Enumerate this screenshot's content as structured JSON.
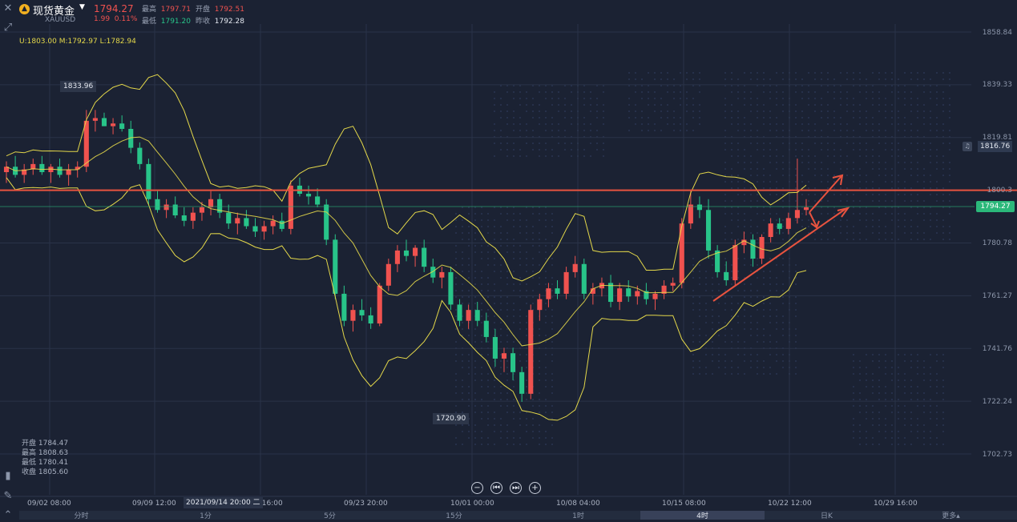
{
  "header": {
    "symbol_name": "现货黄金",
    "symbol_code": "XAUUSD",
    "last_price": "1794.27",
    "change": "1.99",
    "change_pct": "0.11%",
    "high_label": "最高",
    "high_value": "1797.71",
    "open_label": "开盘",
    "open_value": "1792.51",
    "low_label": "最低",
    "low_value": "1791.20",
    "prev_close_label": "昨收",
    "prev_close_value": "1792.28"
  },
  "bollinger": "U:1803.00  M:1792.97  L:1782.94",
  "hover_ohlc": {
    "open": "开盘 1784.47",
    "high": "最高 1808.63",
    "low": "最低 1780.41",
    "close": "收盘 1805.60"
  },
  "crosshair_date": "2021/09/14 20:00 二",
  "price_tag": "1794.27",
  "alert_price": "1816.76",
  "extreme_high": "1833.96",
  "extreme_low": "1720.90",
  "timeframes": [
    "分时",
    "1分",
    "5分",
    "15分",
    "1时",
    "4时",
    "日K",
    "更多▴"
  ],
  "active_timeframe": 5,
  "colors": {
    "up": "#f0524f",
    "down": "#28c489",
    "band": "#e4d84a",
    "resistance": "#e8533f",
    "bg": "#1b2233"
  },
  "icons": [
    "close-icon",
    "draw-tool-icon",
    "indicator-icon",
    "pen-icon",
    "collapse-icon",
    "zoom-out-icon",
    "prev-icon",
    "next-icon",
    "zoom-in-icon",
    "bell-icon"
  ],
  "chart_data": {
    "type": "candlestick",
    "ylim": [
      1695,
      1865
    ],
    "y_ticks": [
      1858.84,
      1839.33,
      1819.81,
      1800.3,
      1780.78,
      1761.27,
      1741.76,
      1722.24,
      1702.73
    ],
    "x_ticks": [
      "09/02 08:00",
      "09/09 12:00",
      "09/16 16:00",
      "09/23 20:00",
      "10/01 00:00",
      "10/08 04:00",
      "10/15 08:00",
      "10/22 12:00",
      "10/29 16:00"
    ],
    "resistance_level": 1800.3,
    "last_close": 1794.27,
    "anchors": [
      [
        1808
      ],
      [
        1812
      ],
      [
        1809
      ],
      [
        1806
      ],
      [
        1809
      ],
      [
        1828
      ],
      [
        1825
      ],
      [
        1822
      ],
      [
        1812
      ],
      [
        1808
      ],
      [
        1795
      ],
      [
        1792
      ],
      [
        1788
      ],
      [
        1793
      ],
      [
        1797
      ],
      [
        1791
      ],
      [
        1786
      ],
      [
        1790
      ],
      [
        1788
      ],
      [
        1784
      ],
      [
        1786
      ],
      [
        1787
      ],
      [
        1800
      ],
      [
        1800
      ],
      [
        1797
      ],
      [
        1791
      ],
      [
        1760
      ],
      [
        1753
      ],
      [
        1757
      ],
      [
        1751
      ],
      [
        1764
      ],
      [
        1779
      ],
      [
        1776
      ],
      [
        1779
      ],
      [
        1765
      ],
      [
        1769
      ],
      [
        1758
      ],
      [
        1752
      ],
      [
        1757
      ],
      [
        1752
      ],
      [
        1747
      ],
      [
        1737
      ],
      [
        1738
      ],
      [
        1733
      ],
      [
        1724
      ],
      [
        1756
      ],
      [
        1763
      ],
      [
        1764
      ],
      [
        1762
      ],
      [
        1766
      ],
      [
        1774
      ],
      [
        1763
      ],
      [
        1765
      ],
      [
        1766
      ],
      [
        1760
      ],
      [
        1767
      ],
      [
        1762
      ],
      [
        1763
      ],
      [
        1761
      ],
      [
        1765
      ],
      [
        1766
      ],
      [
        1793
      ],
      [
        1796
      ],
      [
        1793
      ],
      [
        1777
      ],
      [
        1770
      ],
      [
        1767
      ],
      [
        1779
      ],
      [
        1782
      ],
      [
        1775
      ],
      [
        1782
      ],
      [
        1788
      ],
      [
        1787
      ],
      [
        1789
      ],
      [
        1793
      ],
      [
        1795
      ]
    ],
    "candles": [
      [
        1807,
        1811,
        1803,
        1809
      ],
      [
        1809,
        1813,
        1805,
        1806
      ],
      [
        1806,
        1810,
        1803,
        1808
      ],
      [
        1808,
        1812,
        1806,
        1810
      ],
      [
        1810,
        1813,
        1806,
        1807
      ],
      [
        1807,
        1810,
        1803,
        1809
      ],
      [
        1809,
        1812,
        1805,
        1806
      ],
      [
        1806,
        1810,
        1802,
        1808
      ],
      [
        1808,
        1811,
        1805,
        1809
      ],
      [
        1809,
        1830,
        1807,
        1826
      ],
      [
        1826,
        1830,
        1822,
        1827
      ],
      [
        1827,
        1829,
        1824,
        1824
      ],
      [
        1824,
        1827,
        1821,
        1825
      ],
      [
        1825,
        1828,
        1822,
        1823
      ],
      [
        1823,
        1826,
        1814,
        1816
      ],
      [
        1816,
        1818,
        1808,
        1810
      ],
      [
        1810,
        1812,
        1795,
        1797
      ],
      [
        1797,
        1800,
        1792,
        1793
      ],
      [
        1793,
        1797,
        1790,
        1795
      ],
      [
        1795,
        1798,
        1790,
        1791
      ],
      [
        1791,
        1794,
        1787,
        1789
      ],
      [
        1789,
        1794,
        1786,
        1792
      ],
      [
        1792,
        1796,
        1789,
        1794
      ],
      [
        1794,
        1800,
        1791,
        1797
      ],
      [
        1797,
        1799,
        1790,
        1792
      ],
      [
        1792,
        1795,
        1786,
        1788
      ],
      [
        1788,
        1792,
        1784,
        1790
      ],
      [
        1790,
        1793,
        1786,
        1787
      ],
      [
        1787,
        1790,
        1783,
        1785
      ],
      [
        1785,
        1789,
        1782,
        1787
      ],
      [
        1787,
        1791,
        1784,
        1789
      ],
      [
        1789,
        1792,
        1785,
        1786
      ],
      [
        1786,
        1804,
        1784,
        1802
      ],
      [
        1802,
        1805,
        1798,
        1799
      ],
      [
        1799,
        1802,
        1795,
        1798
      ],
      [
        1798,
        1801,
        1794,
        1795
      ],
      [
        1795,
        1797,
        1780,
        1782
      ],
      [
        1782,
        1784,
        1760,
        1762
      ],
      [
        1762,
        1765,
        1750,
        1752
      ],
      [
        1752,
        1758,
        1748,
        1756
      ],
      [
        1756,
        1760,
        1752,
        1754
      ],
      [
        1754,
        1757,
        1749,
        1751
      ],
      [
        1751,
        1766,
        1750,
        1765
      ],
      [
        1765,
        1775,
        1763,
        1773
      ],
      [
        1773,
        1780,
        1770,
        1778
      ],
      [
        1778,
        1782,
        1774,
        1776
      ],
      [
        1776,
        1780,
        1772,
        1779
      ],
      [
        1779,
        1782,
        1770,
        1772
      ],
      [
        1772,
        1775,
        1766,
        1768
      ],
      [
        1768,
        1772,
        1764,
        1770
      ],
      [
        1770,
        1772,
        1756,
        1758
      ],
      [
        1758,
        1760,
        1750,
        1752
      ],
      [
        1752,
        1758,
        1749,
        1756
      ],
      [
        1756,
        1759,
        1750,
        1752
      ],
      [
        1752,
        1755,
        1744,
        1746
      ],
      [
        1746,
        1749,
        1735,
        1738
      ],
      [
        1738,
        1742,
        1733,
        1740
      ],
      [
        1740,
        1742,
        1730,
        1733
      ],
      [
        1733,
        1735,
        1722,
        1725
      ],
      [
        1725,
        1758,
        1723,
        1756
      ],
      [
        1756,
        1762,
        1752,
        1760
      ],
      [
        1760,
        1766,
        1757,
        1764
      ],
      [
        1764,
        1767,
        1760,
        1762
      ],
      [
        1762,
        1772,
        1760,
        1770
      ],
      [
        1770,
        1776,
        1768,
        1773
      ],
      [
        1773,
        1775,
        1760,
        1762
      ],
      [
        1762,
        1766,
        1758,
        1764
      ],
      [
        1764,
        1768,
        1761,
        1766
      ],
      [
        1766,
        1769,
        1757,
        1759
      ],
      [
        1759,
        1766,
        1756,
        1764
      ],
      [
        1764,
        1767,
        1759,
        1761
      ],
      [
        1761,
        1765,
        1758,
        1763
      ],
      [
        1763,
        1766,
        1758,
        1760
      ],
      [
        1760,
        1763,
        1756,
        1762
      ],
      [
        1762,
        1767,
        1760,
        1765
      ],
      [
        1765,
        1768,
        1763,
        1766
      ],
      [
        1766,
        1790,
        1764,
        1788
      ],
      [
        1788,
        1800,
        1786,
        1795
      ],
      [
        1795,
        1798,
        1790,
        1793
      ],
      [
        1793,
        1797,
        1775,
        1778
      ],
      [
        1778,
        1780,
        1768,
        1770
      ],
      [
        1770,
        1774,
        1765,
        1767
      ],
      [
        1767,
        1782,
        1765,
        1780
      ],
      [
        1780,
        1785,
        1777,
        1782
      ],
      [
        1782,
        1784,
        1772,
        1775
      ],
      [
        1775,
        1784,
        1773,
        1783
      ],
      [
        1783,
        1790,
        1781,
        1788
      ],
      [
        1788,
        1790,
        1784,
        1786
      ],
      [
        1786,
        1792,
        1784,
        1790
      ],
      [
        1790,
        1812,
        1788,
        1793
      ],
      [
        1793,
        1797,
        1791,
        1794
      ]
    ]
  }
}
